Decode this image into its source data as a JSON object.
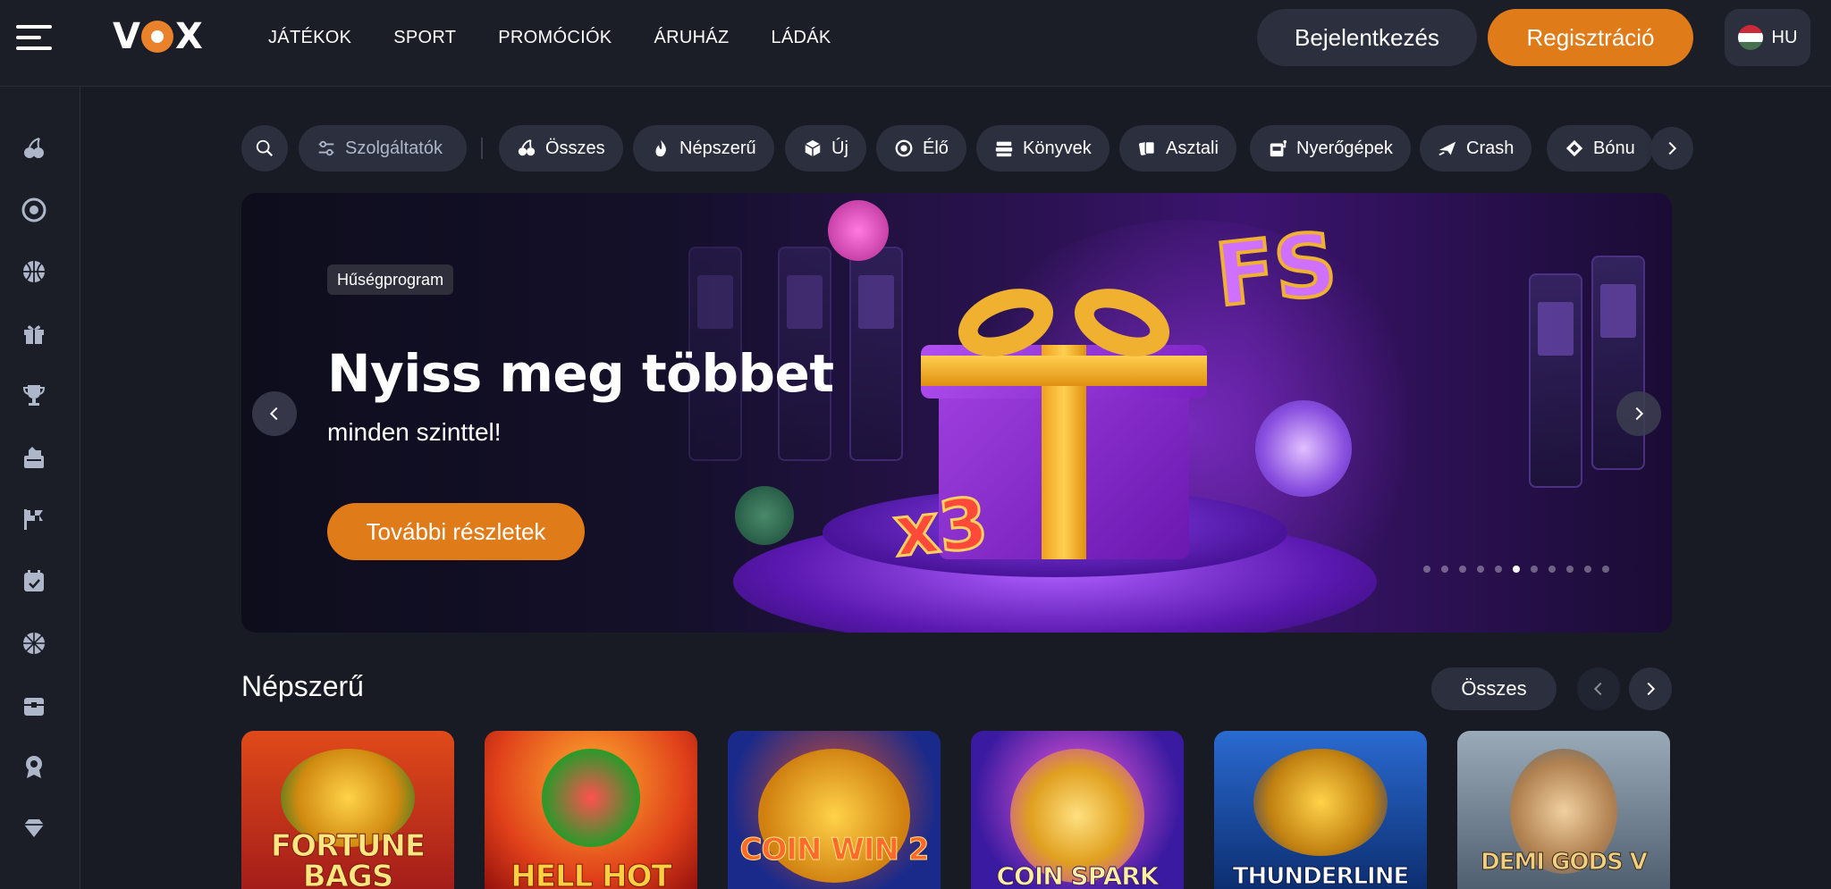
{
  "header": {
    "logo": "VOX",
    "nav": [
      "JÁTÉKOK",
      "SPORT",
      "PROMÓCIÓK",
      "ÁRUHÁZ",
      "LÁDÁK"
    ],
    "login_label": "Bejelentkezés",
    "register_label": "Regisztráció",
    "language": "HU"
  },
  "sidebar": {
    "icons": [
      "cherries-icon",
      "roulette-icon",
      "basketball-icon",
      "gift-icon",
      "trophy-icon",
      "casino-chip-stack-icon",
      "race-flag-icon",
      "calendar-icon",
      "sports-ball-icon",
      "treasure-chest-icon",
      "badge-icon",
      "diamond-icon"
    ]
  },
  "filters": {
    "services_label": "Szolgáltatók",
    "categories": [
      {
        "label": "Összes",
        "icon": "cherries-icon"
      },
      {
        "label": "Népszerű",
        "icon": "flame-icon"
      },
      {
        "label": "Új",
        "icon": "cube-icon"
      },
      {
        "label": "Élő",
        "icon": "roulette-icon"
      },
      {
        "label": "Könyvek",
        "icon": "books-icon"
      },
      {
        "label": "Asztali",
        "icon": "cards-icon"
      },
      {
        "label": "Nyerőgépek",
        "icon": "slot-machine-icon"
      },
      {
        "label": "Crash",
        "icon": "plane-icon"
      },
      {
        "label": "Bónu",
        "icon": "diamond-icon"
      }
    ]
  },
  "banner": {
    "tag": "Hűségprogram",
    "title": "Nyiss meg többet",
    "subtitle": "minden szinttel!",
    "button": "További részletek",
    "deco_fs": "FS",
    "deco_x3": "x3",
    "dots_total": 11,
    "dots_active_index": 5
  },
  "popular": {
    "title": "Népszerű",
    "all_label": "Összes",
    "games": [
      {
        "title": "FORTUNE BAGS",
        "bg": "#c02a1a"
      },
      {
        "title": "HELL HOT",
        "bg": "#e0401a"
      },
      {
        "title": "COIN WIN 2",
        "bg": "#1a2a8a"
      },
      {
        "title": "COIN SPARK",
        "bg": "#3a1aa0"
      },
      {
        "title": "THUNDERLINE",
        "bg": "#1a4a9a"
      },
      {
        "title": "DEMI GODS V",
        "bg": "#6a7a8a"
      }
    ]
  },
  "colors": {
    "accent": "#e07b1a",
    "background": "#181a24",
    "surface": "#2b2f3e"
  }
}
